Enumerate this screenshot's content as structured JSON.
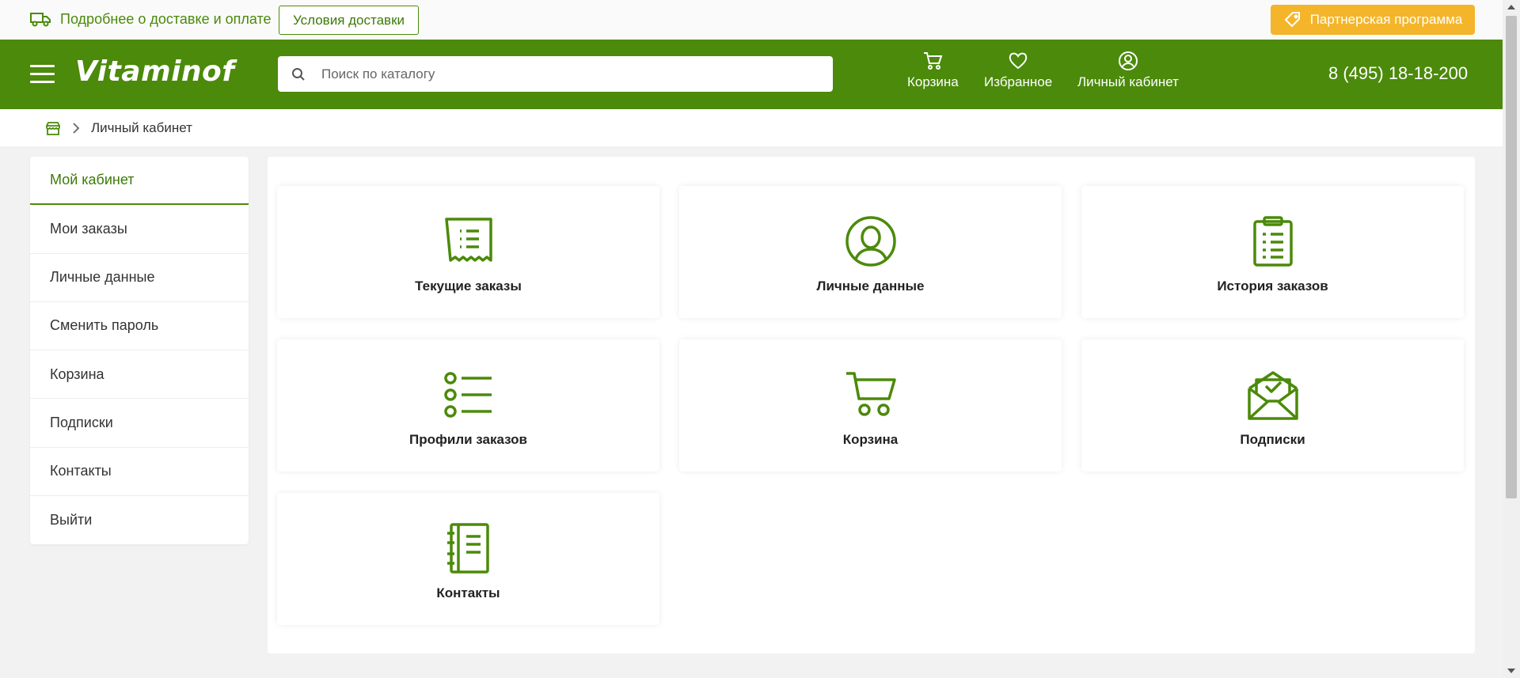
{
  "topbar": {
    "delivery_text": "Подробнее о доставке и оплате",
    "delivery_conditions_btn": "Условия доставки",
    "partner_btn": "Партнерская программа"
  },
  "header": {
    "logo": "Vitaminof",
    "search_placeholder": "Поиск по каталогу",
    "nav": {
      "cart": "Корзина",
      "favorites": "Избранное",
      "account": "Личный кабинет"
    },
    "phone": "8 (495) 18-18-200"
  },
  "breadcrumb": {
    "current": "Личный кабинет"
  },
  "sidebar": {
    "items": [
      {
        "label": "Мой кабинет"
      },
      {
        "label": "Мои заказы"
      },
      {
        "label": "Личные данные"
      },
      {
        "label": "Сменить пароль"
      },
      {
        "label": "Корзина"
      },
      {
        "label": "Подписки"
      },
      {
        "label": "Контакты"
      },
      {
        "label": "Выйти"
      }
    ]
  },
  "cards": [
    {
      "label": "Текущие заказы",
      "icon": "receipt-icon"
    },
    {
      "label": "Личные данные",
      "icon": "user-circle-icon"
    },
    {
      "label": "История заказов",
      "icon": "clipboard-list-icon"
    },
    {
      "label": "Профили заказов",
      "icon": "list-icon"
    },
    {
      "label": "Корзина",
      "icon": "cart-icon"
    },
    {
      "label": "Подписки",
      "icon": "envelope-check-icon"
    },
    {
      "label": "Контакты",
      "icon": "notebook-icon"
    }
  ],
  "colors": {
    "brand_green": "#4b8a0a",
    "accent_orange": "#f4b52a"
  }
}
